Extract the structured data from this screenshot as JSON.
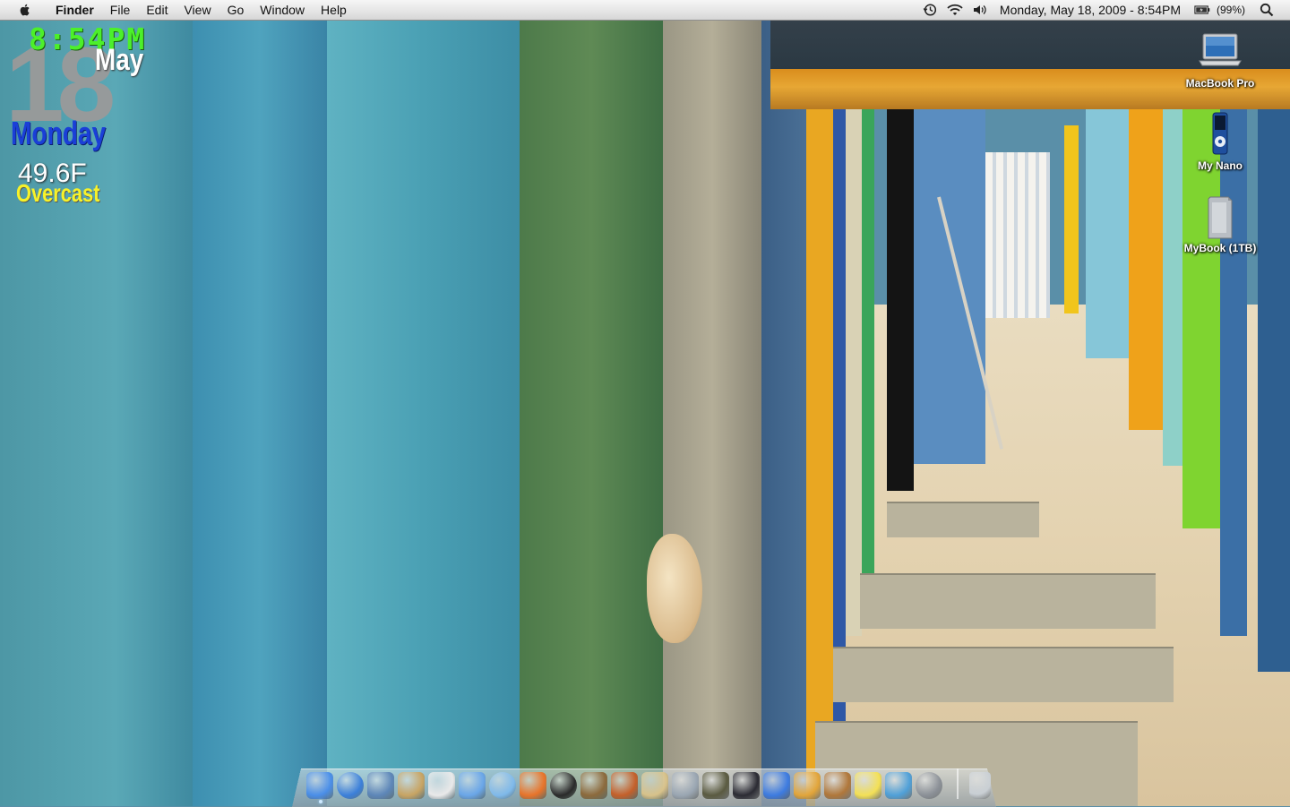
{
  "menubar": {
    "apple_icon": "apple-icon",
    "app_name": "Finder",
    "menus": [
      "File",
      "Edit",
      "View",
      "Go",
      "Window",
      "Help"
    ],
    "status_icons": [
      "time-machine-icon",
      "wifi-icon",
      "volume-icon"
    ],
    "clock": "Monday, May 18, 2009 - 8:54PM",
    "battery_icon": "battery-icon",
    "battery_percent": "(99%)",
    "spotlight_icon": "spotlight-icon"
  },
  "widget": {
    "time": "8:54PM",
    "day_number": "18",
    "month": "May",
    "weekday": "Monday",
    "temperature": "49.6F",
    "condition": "Overcast",
    "colors": {
      "time": "#4cf02a",
      "weekday": "#1a3fd8",
      "condition": "#f6f22a"
    }
  },
  "desktop_icons": [
    {
      "label": "MacBook Pro",
      "icon": "laptop-icon"
    },
    {
      "label": "My Nano",
      "icon": "ipod-nano-icon"
    },
    {
      "label": "MyBook (1TB)",
      "icon": "external-drive-icon"
    }
  ],
  "dock": {
    "items": [
      {
        "name": "finder",
        "icon": "finder-icon",
        "color": "#4a8ee8"
      },
      {
        "name": "safari",
        "icon": "safari-icon",
        "color": "#3b7fd9"
      },
      {
        "name": "mail",
        "icon": "mail-icon",
        "color": "#5d86b8"
      },
      {
        "name": "address-book",
        "icon": "address-book-icon",
        "color": "#c8a463"
      },
      {
        "name": "ical",
        "icon": "calendar-icon",
        "color": "#e9e9e9"
      },
      {
        "name": "widgets",
        "icon": "widgets-icon",
        "color": "#6aa6e8"
      },
      {
        "name": "itunes",
        "icon": "itunes-icon",
        "color": "#7fb9ea"
      },
      {
        "name": "feather-app",
        "icon": "feather-icon",
        "color": "#e8742a"
      },
      {
        "name": "photo-booth",
        "icon": "camera-lens-icon",
        "color": "#2a2a2a"
      },
      {
        "name": "iphoto",
        "icon": "iphoto-icon",
        "color": "#8c6a3c"
      },
      {
        "name": "aperture",
        "icon": "aperture-icon",
        "color": "#c4602a"
      },
      {
        "name": "preview",
        "icon": "preview-icon",
        "color": "#d8c28a"
      },
      {
        "name": "archive",
        "icon": "box-icon",
        "color": "#9aa6b2"
      },
      {
        "name": "star-app",
        "icon": "star-icon",
        "color": "#5a5a40"
      },
      {
        "name": "device",
        "icon": "phone-icon",
        "color": "#2b2b33"
      },
      {
        "name": "app-store",
        "icon": "app-store-icon",
        "color": "#3d7be0"
      },
      {
        "name": "pineapple-app",
        "icon": "pineapple-icon",
        "color": "#e2a53a"
      },
      {
        "name": "fetch-app",
        "icon": "dog-icon",
        "color": "#b0773a"
      },
      {
        "name": "stickies",
        "icon": "stickies-icon",
        "color": "#f3e056"
      },
      {
        "name": "chart-app",
        "icon": "chart-icon",
        "color": "#4fa0d8"
      },
      {
        "name": "system-preferences",
        "icon": "gear-icon",
        "color": "#8a8f96"
      },
      {
        "name": "trash",
        "icon": "trash-icon",
        "color": "#c9cfd4"
      }
    ]
  }
}
